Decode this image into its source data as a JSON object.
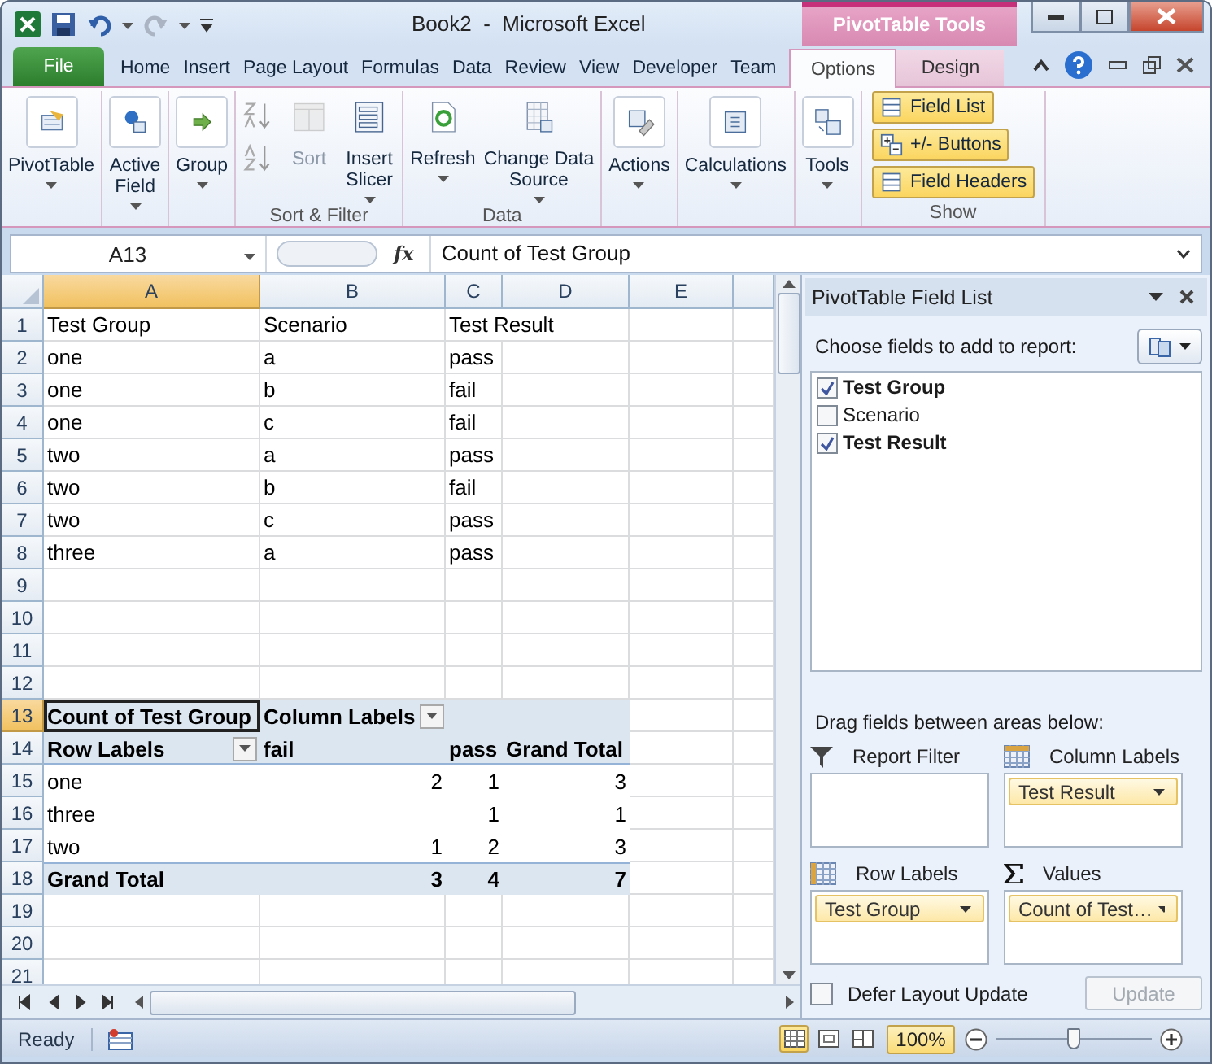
{
  "window": {
    "title": "Book2  -  Microsoft Excel",
    "context_title": "PivotTable Tools"
  },
  "tabs": [
    {
      "label": "File",
      "kind": "file",
      "selected": false
    },
    {
      "label": "Home",
      "kind": "normal",
      "selected": false
    },
    {
      "label": "Insert",
      "kind": "normal",
      "selected": false
    },
    {
      "label": "Page Layout",
      "kind": "normal",
      "selected": false
    },
    {
      "label": "Formulas",
      "kind": "normal",
      "selected": false
    },
    {
      "label": "Data",
      "kind": "normal",
      "selected": false
    },
    {
      "label": "Review",
      "kind": "normal",
      "selected": false
    },
    {
      "label": "View",
      "kind": "normal",
      "selected": false
    },
    {
      "label": "Developer",
      "kind": "normal",
      "selected": false
    },
    {
      "label": "Team",
      "kind": "normal",
      "selected": false
    },
    {
      "label": "Options",
      "kind": "contextual",
      "selected": true
    },
    {
      "label": "Design",
      "kind": "contextual",
      "selected": false
    }
  ],
  "ribbon": {
    "groups": [
      {
        "buttons": [
          {
            "label": "PivotTable",
            "kind": "large",
            "dropdown": true,
            "disabled": false
          }
        ]
      },
      {
        "buttons": [
          {
            "label": "Active\nField",
            "kind": "large",
            "dropdown": true,
            "disabled": false
          }
        ]
      },
      {
        "buttons": [
          {
            "label": "Group",
            "kind": "large",
            "dropdown": true,
            "disabled": false
          }
        ]
      },
      {
        "label": "Sort & Filter",
        "buttons": [
          {
            "kind": "small",
            "disabled": true
          },
          {
            "kind": "small",
            "disabled": true
          },
          {
            "label": "Sort",
            "kind": "large",
            "dropdown": false,
            "disabled": true
          },
          {
            "label": "Insert\nSlicer",
            "kind": "large",
            "dropdown": true,
            "disabled": false
          }
        ]
      },
      {
        "label": "Data",
        "buttons": [
          {
            "label": "Refresh",
            "kind": "large",
            "dropdown": true,
            "disabled": false
          },
          {
            "label": "Change Data\nSource",
            "kind": "large",
            "dropdown": true,
            "disabled": false
          }
        ]
      },
      {
        "buttons": [
          {
            "label": "Actions",
            "kind": "large",
            "dropdown": true,
            "disabled": false
          }
        ]
      },
      {
        "buttons": [
          {
            "label": "Calculations",
            "kind": "large",
            "dropdown": true,
            "disabled": false
          }
        ]
      },
      {
        "buttons": [
          {
            "label": "Tools",
            "kind": "large",
            "dropdown": true,
            "disabled": false
          }
        ]
      },
      {
        "label": "Show",
        "buttons": [
          {
            "label": "Field List",
            "kind": "toggle",
            "on": true
          },
          {
            "label": "+/- Buttons",
            "kind": "toggle",
            "on": true
          },
          {
            "label": "Field Headers",
            "kind": "toggle",
            "on": true
          }
        ]
      }
    ]
  },
  "formula_bar": {
    "name_box": "A13",
    "function_button": "fx",
    "value": "Count of Test Group"
  },
  "sheet": {
    "columns": [
      {
        "label": "A",
        "selected": true
      },
      {
        "label": "B",
        "selected": false
      },
      {
        "label": "C",
        "selected": false
      },
      {
        "label": "D",
        "selected": false
      },
      {
        "label": "E",
        "selected": false
      }
    ],
    "rows": [
      {
        "number": "1",
        "kind": "data",
        "selected": false,
        "cells": {
          "A": "Test Group",
          "B": "Scenario",
          "C": "Test Result"
        }
      },
      {
        "number": "2",
        "kind": "data",
        "selected": false,
        "cells": {
          "A": "one",
          "B": "a",
          "C": "pass"
        }
      },
      {
        "number": "3",
        "kind": "data",
        "selected": false,
        "cells": {
          "A": "one",
          "B": "b",
          "C": "fail"
        }
      },
      {
        "number": "4",
        "kind": "data",
        "selected": false,
        "cells": {
          "A": "one",
          "B": "c",
          "C": "fail"
        }
      },
      {
        "number": "5",
        "kind": "data",
        "selected": false,
        "cells": {
          "A": "two",
          "B": "a",
          "C": "pass"
        }
      },
      {
        "number": "6",
        "kind": "data",
        "selected": false,
        "cells": {
          "A": "two",
          "B": "b",
          "C": "fail"
        }
      },
      {
        "number": "7",
        "kind": "data",
        "selected": false,
        "cells": {
          "A": "two",
          "B": "c",
          "C": "pass"
        }
      },
      {
        "number": "8",
        "kind": "data",
        "selected": false,
        "cells": {
          "A": "three",
          "B": "a",
          "C": "pass"
        }
      },
      {
        "number": "9",
        "kind": "data",
        "selected": false
      },
      {
        "number": "10",
        "kind": "data",
        "selected": false
      },
      {
        "number": "11",
        "kind": "data",
        "selected": false
      },
      {
        "number": "12",
        "kind": "data",
        "selected": false
      },
      {
        "number": "13",
        "kind": "pivot_header",
        "selected": true,
        "cells": {
          "A": {
            "text": "Count of Test Group",
            "selected": true,
            "filter": false
          },
          "B": {
            "text": "Column Labels",
            "selected": false,
            "filter": true
          }
        }
      },
      {
        "number": "14",
        "kind": "pivot_labels",
        "selected": false,
        "cells": {
          "A": {
            "text": "Row Labels",
            "filter": true
          },
          "B": "fail",
          "C": "pass",
          "D": "Grand Total"
        }
      },
      {
        "number": "15",
        "kind": "pivot_row",
        "selected": false,
        "cells": {
          "A": "one",
          "B": "2",
          "C": "1",
          "D": "3"
        }
      },
      {
        "number": "16",
        "kind": "pivot_row",
        "selected": false,
        "cells": {
          "A": "three",
          "C": "1",
          "D": "1"
        }
      },
      {
        "number": "17",
        "kind": "pivot_row",
        "selected": false,
        "cells": {
          "A": "two",
          "B": "1",
          "C": "2",
          "D": "3"
        }
      },
      {
        "number": "18",
        "kind": "pivot_total",
        "selected": false,
        "cells": {
          "A": "Grand Total",
          "B": "3",
          "C": "4",
          "D": "7"
        }
      },
      {
        "number": "19",
        "kind": "data",
        "selected": false
      },
      {
        "number": "20",
        "kind": "data",
        "selected": false
      },
      {
        "number": "21",
        "kind": "data",
        "selected": false
      }
    ]
  },
  "field_list": {
    "title": "PivotTable Field List",
    "choose_label": "Choose fields to add to report:",
    "fields": [
      {
        "label": "Test Group",
        "checked": true
      },
      {
        "label": "Scenario",
        "checked": false
      },
      {
        "label": "Test Result",
        "checked": true
      }
    ],
    "drag_label": "Drag fields between areas below:",
    "areas": [
      {
        "label": "Report Filter",
        "kind": "filter"
      },
      {
        "label": "Column Labels",
        "kind": "columns",
        "items": [
          "Test Result"
        ]
      },
      {
        "label": "Row Labels",
        "kind": "rows",
        "items": [
          "Test Group"
        ]
      },
      {
        "label": "Values",
        "kind": "values",
        "items": [
          "Count of Test…"
        ]
      }
    ],
    "defer": {
      "label": "Defer Layout Update",
      "checked": false
    },
    "update": {
      "label": "Update",
      "disabled": true
    }
  },
  "status_bar": {
    "status": "Ready",
    "views": [
      {
        "kind": "normal",
        "selected": true
      },
      {
        "kind": "page_layout",
        "selected": false
      },
      {
        "kind": "page_break",
        "selected": false
      }
    ],
    "zoom": "100%",
    "zoom_slider": {
      "level": 0.5
    }
  }
}
